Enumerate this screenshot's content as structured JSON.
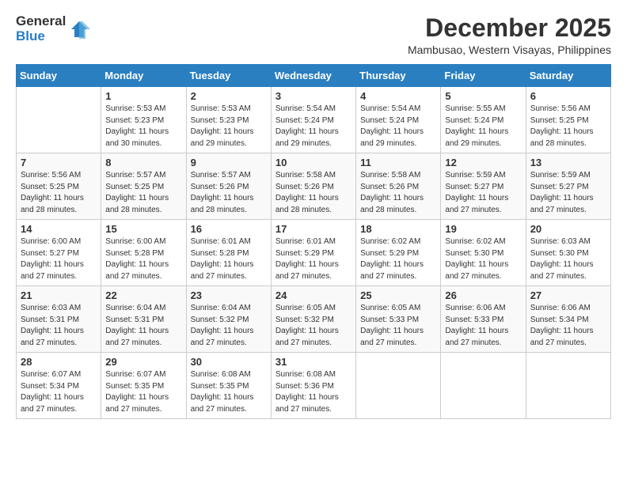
{
  "logo": {
    "general": "General",
    "blue": "Blue"
  },
  "title": "December 2025",
  "location": "Mambusao, Western Visayas, Philippines",
  "days_of_week": [
    "Sunday",
    "Monday",
    "Tuesday",
    "Wednesday",
    "Thursday",
    "Friday",
    "Saturday"
  ],
  "weeks": [
    [
      {
        "date": "",
        "info": ""
      },
      {
        "date": "1",
        "info": "Sunrise: 5:53 AM\nSunset: 5:23 PM\nDaylight: 11 hours\nand 30 minutes."
      },
      {
        "date": "2",
        "info": "Sunrise: 5:53 AM\nSunset: 5:23 PM\nDaylight: 11 hours\nand 29 minutes."
      },
      {
        "date": "3",
        "info": "Sunrise: 5:54 AM\nSunset: 5:24 PM\nDaylight: 11 hours\nand 29 minutes."
      },
      {
        "date": "4",
        "info": "Sunrise: 5:54 AM\nSunset: 5:24 PM\nDaylight: 11 hours\nand 29 minutes."
      },
      {
        "date": "5",
        "info": "Sunrise: 5:55 AM\nSunset: 5:24 PM\nDaylight: 11 hours\nand 29 minutes."
      },
      {
        "date": "6",
        "info": "Sunrise: 5:56 AM\nSunset: 5:25 PM\nDaylight: 11 hours\nand 28 minutes."
      }
    ],
    [
      {
        "date": "7",
        "info": "Sunrise: 5:56 AM\nSunset: 5:25 PM\nDaylight: 11 hours\nand 28 minutes."
      },
      {
        "date": "8",
        "info": "Sunrise: 5:57 AM\nSunset: 5:25 PM\nDaylight: 11 hours\nand 28 minutes."
      },
      {
        "date": "9",
        "info": "Sunrise: 5:57 AM\nSunset: 5:26 PM\nDaylight: 11 hours\nand 28 minutes."
      },
      {
        "date": "10",
        "info": "Sunrise: 5:58 AM\nSunset: 5:26 PM\nDaylight: 11 hours\nand 28 minutes."
      },
      {
        "date": "11",
        "info": "Sunrise: 5:58 AM\nSunset: 5:26 PM\nDaylight: 11 hours\nand 28 minutes."
      },
      {
        "date": "12",
        "info": "Sunrise: 5:59 AM\nSunset: 5:27 PM\nDaylight: 11 hours\nand 27 minutes."
      },
      {
        "date": "13",
        "info": "Sunrise: 5:59 AM\nSunset: 5:27 PM\nDaylight: 11 hours\nand 27 minutes."
      }
    ],
    [
      {
        "date": "14",
        "info": "Sunrise: 6:00 AM\nSunset: 5:27 PM\nDaylight: 11 hours\nand 27 minutes."
      },
      {
        "date": "15",
        "info": "Sunrise: 6:00 AM\nSunset: 5:28 PM\nDaylight: 11 hours\nand 27 minutes."
      },
      {
        "date": "16",
        "info": "Sunrise: 6:01 AM\nSunset: 5:28 PM\nDaylight: 11 hours\nand 27 minutes."
      },
      {
        "date": "17",
        "info": "Sunrise: 6:01 AM\nSunset: 5:29 PM\nDaylight: 11 hours\nand 27 minutes."
      },
      {
        "date": "18",
        "info": "Sunrise: 6:02 AM\nSunset: 5:29 PM\nDaylight: 11 hours\nand 27 minutes."
      },
      {
        "date": "19",
        "info": "Sunrise: 6:02 AM\nSunset: 5:30 PM\nDaylight: 11 hours\nand 27 minutes."
      },
      {
        "date": "20",
        "info": "Sunrise: 6:03 AM\nSunset: 5:30 PM\nDaylight: 11 hours\nand 27 minutes."
      }
    ],
    [
      {
        "date": "21",
        "info": "Sunrise: 6:03 AM\nSunset: 5:31 PM\nDaylight: 11 hours\nand 27 minutes."
      },
      {
        "date": "22",
        "info": "Sunrise: 6:04 AM\nSunset: 5:31 PM\nDaylight: 11 hours\nand 27 minutes."
      },
      {
        "date": "23",
        "info": "Sunrise: 6:04 AM\nSunset: 5:32 PM\nDaylight: 11 hours\nand 27 minutes."
      },
      {
        "date": "24",
        "info": "Sunrise: 6:05 AM\nSunset: 5:32 PM\nDaylight: 11 hours\nand 27 minutes."
      },
      {
        "date": "25",
        "info": "Sunrise: 6:05 AM\nSunset: 5:33 PM\nDaylight: 11 hours\nand 27 minutes."
      },
      {
        "date": "26",
        "info": "Sunrise: 6:06 AM\nSunset: 5:33 PM\nDaylight: 11 hours\nand 27 minutes."
      },
      {
        "date": "27",
        "info": "Sunrise: 6:06 AM\nSunset: 5:34 PM\nDaylight: 11 hours\nand 27 minutes."
      }
    ],
    [
      {
        "date": "28",
        "info": "Sunrise: 6:07 AM\nSunset: 5:34 PM\nDaylight: 11 hours\nand 27 minutes."
      },
      {
        "date": "29",
        "info": "Sunrise: 6:07 AM\nSunset: 5:35 PM\nDaylight: 11 hours\nand 27 minutes."
      },
      {
        "date": "30",
        "info": "Sunrise: 6:08 AM\nSunset: 5:35 PM\nDaylight: 11 hours\nand 27 minutes."
      },
      {
        "date": "31",
        "info": "Sunrise: 6:08 AM\nSunset: 5:36 PM\nDaylight: 11 hours\nand 27 minutes."
      },
      {
        "date": "",
        "info": ""
      },
      {
        "date": "",
        "info": ""
      },
      {
        "date": "",
        "info": ""
      }
    ]
  ]
}
